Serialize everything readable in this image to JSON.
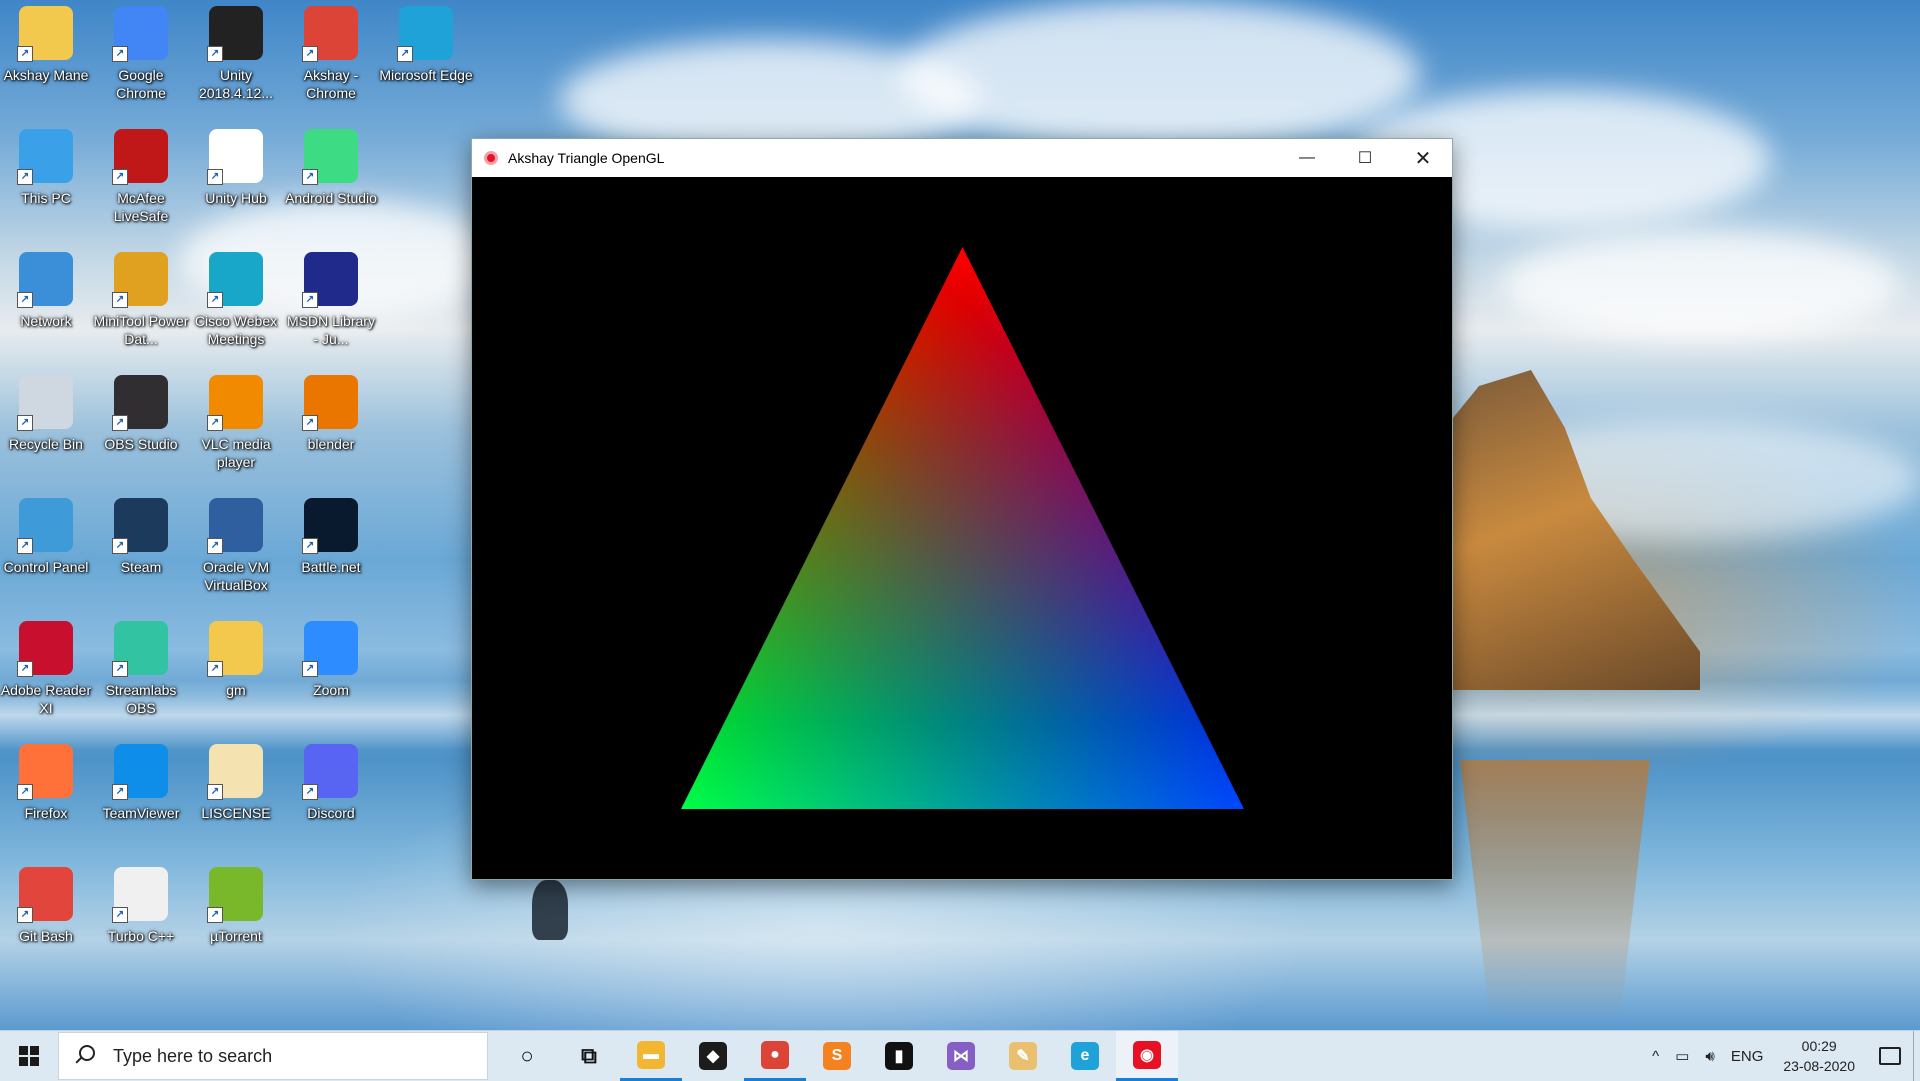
{
  "desktop_icons": [
    {
      "label": "Akshay Mane",
      "icon": "user-folder-icon",
      "color": "#f2c94c"
    },
    {
      "label": "Google Chrome",
      "icon": "chrome-icon",
      "color": "#4285f4"
    },
    {
      "label": "Unity 2018.4.12...",
      "icon": "unity-icon",
      "color": "#222222"
    },
    {
      "label": "Akshay - Chrome",
      "icon": "chrome-profile-icon",
      "color": "#db4437"
    },
    {
      "label": "Microsoft Edge",
      "icon": "edge-icon",
      "color": "#1fa2d8"
    },
    {
      "label": "This PC",
      "icon": "computer-icon",
      "color": "#3aa0e8"
    },
    {
      "label": "McAfee LiveSafe",
      "icon": "mcafee-icon",
      "color": "#c01818"
    },
    {
      "label": "Unity Hub",
      "icon": "unity-hub-icon",
      "color": "#ffffff"
    },
    {
      "label": "Android Studio",
      "icon": "android-studio-icon",
      "color": "#3ddc84"
    },
    {
      "label": "Network",
      "icon": "network-icon",
      "color": "#3a8fd8"
    },
    {
      "label": "MiniTool Power Dat...",
      "icon": "minitool-icon",
      "color": "#e0a020"
    },
    {
      "label": "Cisco Webex Meetings",
      "icon": "webex-icon",
      "color": "#19a7c9"
    },
    {
      "label": "MSDN Library - Ju...",
      "icon": "msdn-icon",
      "color": "#1f2a8a"
    },
    {
      "label": "Recycle Bin",
      "icon": "recycle-bin-icon",
      "color": "#cfd8e0"
    },
    {
      "label": "OBS Studio",
      "icon": "obs-icon",
      "color": "#302e31"
    },
    {
      "label": "VLC media player",
      "icon": "vlc-icon",
      "color": "#f28a00"
    },
    {
      "label": "blender",
      "icon": "blender-icon",
      "color": "#ea7600"
    },
    {
      "label": "Control Panel",
      "icon": "control-panel-icon",
      "color": "#3f9ad8"
    },
    {
      "label": "Steam",
      "icon": "steam-icon",
      "color": "#1b3a5c"
    },
    {
      "label": "Oracle VM VirtualBox",
      "icon": "virtualbox-icon",
      "color": "#2f5f9f"
    },
    {
      "label": "Battle.net",
      "icon": "battlenet-icon",
      "color": "#0a1a2e"
    },
    {
      "label": "Adobe Reader XI",
      "icon": "adobe-reader-icon",
      "color": "#c8102e"
    },
    {
      "label": "Streamlabs OBS",
      "icon": "streamlabs-icon",
      "color": "#31c3a2"
    },
    {
      "label": "gm",
      "icon": "folder-icon",
      "color": "#f2c94c"
    },
    {
      "label": "Zoom",
      "icon": "zoom-icon",
      "color": "#2d8cff"
    },
    {
      "label": "Firefox",
      "icon": "firefox-icon",
      "color": "#ff7139"
    },
    {
      "label": "TeamViewer",
      "icon": "teamviewer-icon",
      "color": "#0e8ee9"
    },
    {
      "label": "LISCENSE",
      "icon": "pdf-file-icon",
      "color": "#f4e3b0"
    },
    {
      "label": "Discord",
      "icon": "discord-icon",
      "color": "#5865f2"
    },
    {
      "label": "Git Bash",
      "icon": "git-bash-icon",
      "color": "#e2453c"
    },
    {
      "label": "Turbo C++",
      "icon": "turbo-cpp-icon",
      "color": "#f0f0f0"
    },
    {
      "label": "µTorrent",
      "icon": "utorrent-icon",
      "color": "#78b82a"
    }
  ],
  "window": {
    "title": "Akshay Triangle OpenGL",
    "minimize_symbol": "—",
    "maximize_symbol": "☐",
    "close_symbol": "✕",
    "vertex_colors": {
      "top": "#ff0000",
      "bottom_left": "#00ff00",
      "bottom_right": "#0000ff"
    },
    "background_color": "#000000"
  },
  "taskbar": {
    "search_placeholder": "Type here to search",
    "pinned": [
      {
        "name": "cortana-icon",
        "glyph": "○",
        "color": "#dce8f2",
        "active": false
      },
      {
        "name": "task-view-icon",
        "glyph": "⧉",
        "color": "#dce8f2",
        "active": false
      },
      {
        "name": "file-explorer-icon",
        "glyph": "▬",
        "color": "#f2b632",
        "active": true
      },
      {
        "name": "predator-sense-icon",
        "glyph": "◆",
        "color": "#1c1c1c",
        "active": false
      },
      {
        "name": "chrome-profile-icon",
        "glyph": "●",
        "color": "#db4437",
        "active": true
      },
      {
        "name": "sublime-text-icon",
        "glyph": "S",
        "color": "#f58220",
        "active": false
      },
      {
        "name": "terminal-icon",
        "glyph": "▮",
        "color": "#111111",
        "active": false
      },
      {
        "name": "visual-studio-icon",
        "glyph": "⋈",
        "color": "#865fc5",
        "active": false
      },
      {
        "name": "paint-icon",
        "glyph": "✎",
        "color": "#e8c070",
        "active": false
      },
      {
        "name": "edge-icon",
        "glyph": "e",
        "color": "#1fa2d8",
        "active": false
      },
      {
        "name": "opengl-app-icon",
        "glyph": "◉",
        "color": "#e81123",
        "active": true
      }
    ],
    "tray": {
      "chevron": "^",
      "battery_symbol": "▭",
      "volume_symbol": "🔊︎",
      "language": "ENG",
      "time": "00:29",
      "date": "23-08-2020"
    }
  }
}
